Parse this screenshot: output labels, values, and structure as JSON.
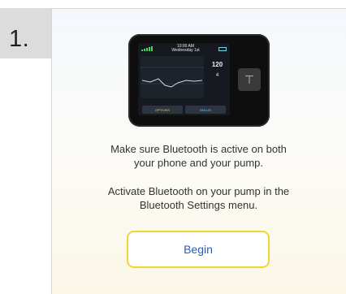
{
  "step": {
    "number": "1."
  },
  "device": {
    "time": "10:00 AM",
    "date": "Wednesday 1st",
    "side_value": "120",
    "side_value_2": "4",
    "option_left": "OPTIONS",
    "option_right": "BOLUS"
  },
  "instructions": {
    "line1": "Make sure Bluetooth is active on both",
    "line2": "your phone and your pump.",
    "line3": "Activate Bluetooth on your pump in the",
    "line4": "Bluetooth Settings menu."
  },
  "actions": {
    "begin_label": "Begin"
  },
  "colors": {
    "button_border": "#f2d630",
    "button_text": "#1f5fbf",
    "step_tab": "#dcdcdc"
  }
}
